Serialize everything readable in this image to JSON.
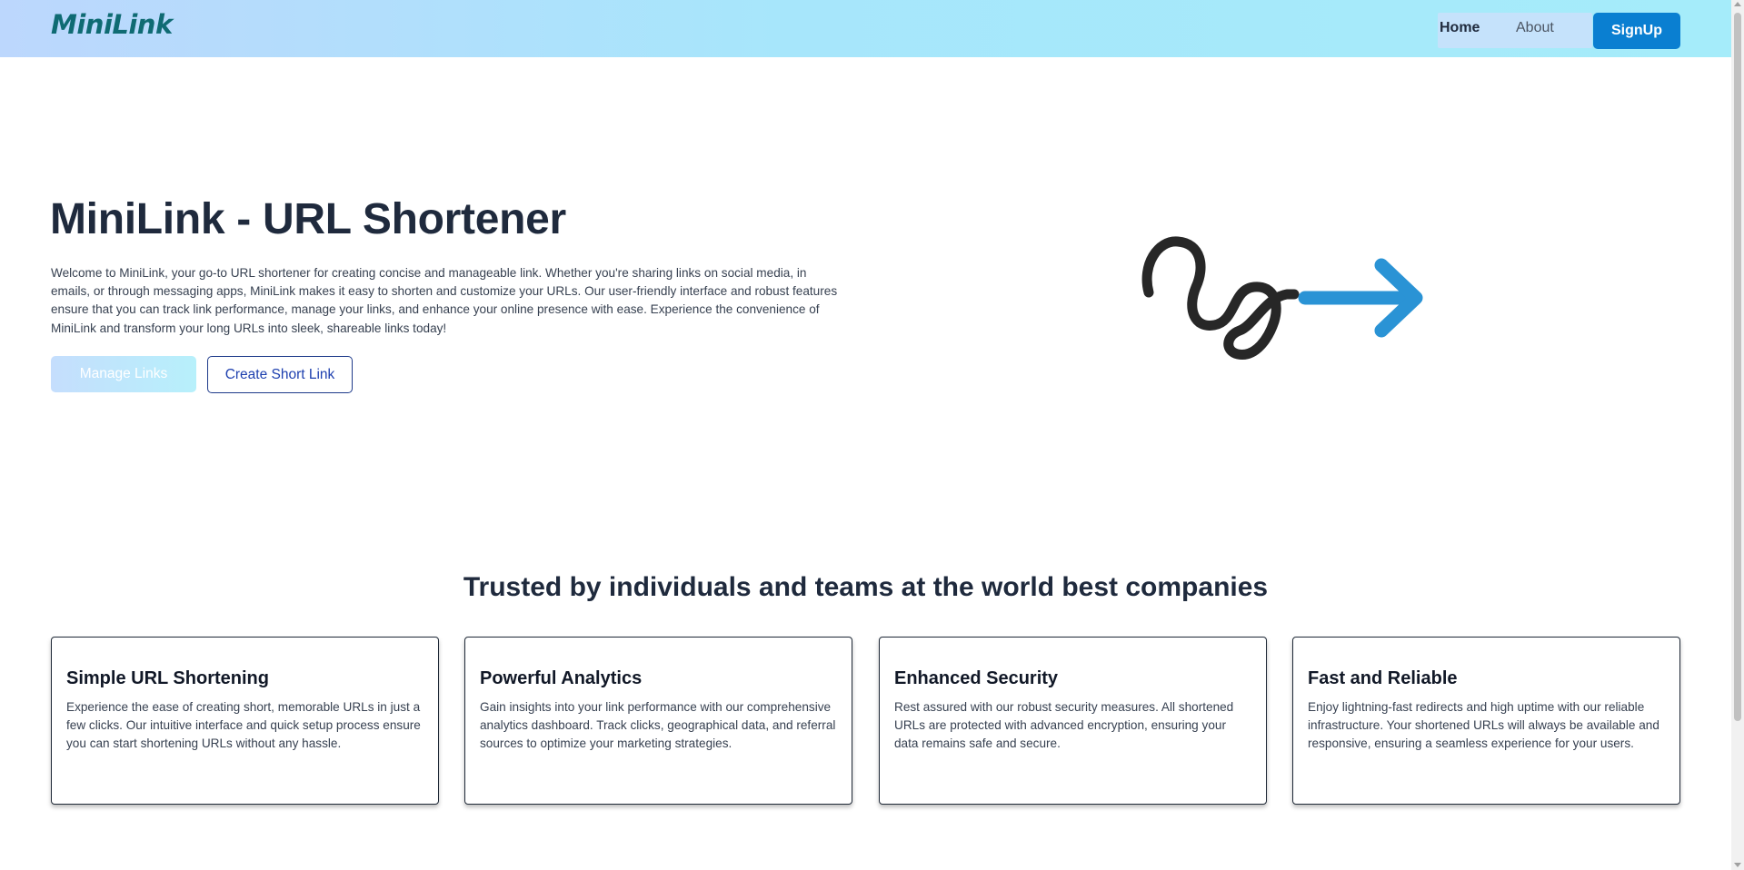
{
  "header": {
    "logo": "MiniLink",
    "nav": {
      "home": "Home",
      "about": "About",
      "signup": "SignUp"
    }
  },
  "hero": {
    "title": "MiniLink - URL Shortener",
    "description": "Welcome to MiniLink, your go-to URL shortener for creating concise and manageable link. Whether you're sharing links on social media, in emails, or through messaging apps, MiniLink makes it easy to shorten and customize your URLs. Our user-friendly interface and robust features ensure that you can track link performance, manage your links, and enhance your online presence with ease. Experience the convenience of MiniLink and transform your long URLs into sleek, shareable links today!",
    "manage_button": "Manage Links",
    "create_button": "Create Short Link"
  },
  "colors": {
    "squiggle": "#272727",
    "arrow": "#2a93d5",
    "signup_bg": "#0a7fd1",
    "logo": "#0f6b73"
  },
  "trusted": {
    "title": "Trusted by individuals and teams at the world best companies",
    "cards": [
      {
        "title": "Simple URL Shortening",
        "text": "Experience the ease of creating short, memorable URLs in just a few clicks. Our intuitive interface and quick setup process ensure you can start shortening URLs without any hassle."
      },
      {
        "title": "Powerful Analytics",
        "text": "Gain insights into your link performance with our comprehensive analytics dashboard. Track clicks, geographical data, and referral sources to optimize your marketing strategies."
      },
      {
        "title": "Enhanced Security",
        "text": "Rest assured with our robust security measures. All shortened URLs are protected with advanced encryption, ensuring your data remains safe and secure."
      },
      {
        "title": "Fast and Reliable",
        "text": "Enjoy lightning-fast redirects and high uptime with our reliable infrastructure. Your shortened URLs will always be available and responsive, ensuring a seamless experience for your users."
      }
    ]
  }
}
